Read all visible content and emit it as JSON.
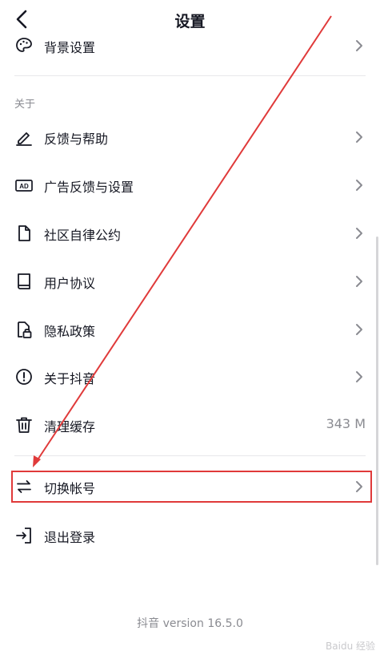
{
  "header": {
    "title": "设置"
  },
  "items": {
    "background": {
      "label": "背景设置"
    },
    "feedback": {
      "label": "反馈与帮助"
    },
    "ad": {
      "label": "广告反馈与设置"
    },
    "community": {
      "label": "社区自律公约"
    },
    "agreement": {
      "label": "用户协议"
    },
    "privacy": {
      "label": "隐私政策"
    },
    "about": {
      "label": "关于抖音"
    },
    "cache": {
      "label": "清理缓存",
      "value": "343 M"
    },
    "switch": {
      "label": "切换帐号"
    },
    "logout": {
      "label": "退出登录"
    }
  },
  "section": {
    "about_label": "关于"
  },
  "footer": {
    "version": "抖音 version 16.5.0"
  },
  "watermark": {
    "text": "Baidu 经验"
  },
  "colors": {
    "annotation": "#e03a3a",
    "text": "#161823",
    "muted": "#8a8b91"
  }
}
